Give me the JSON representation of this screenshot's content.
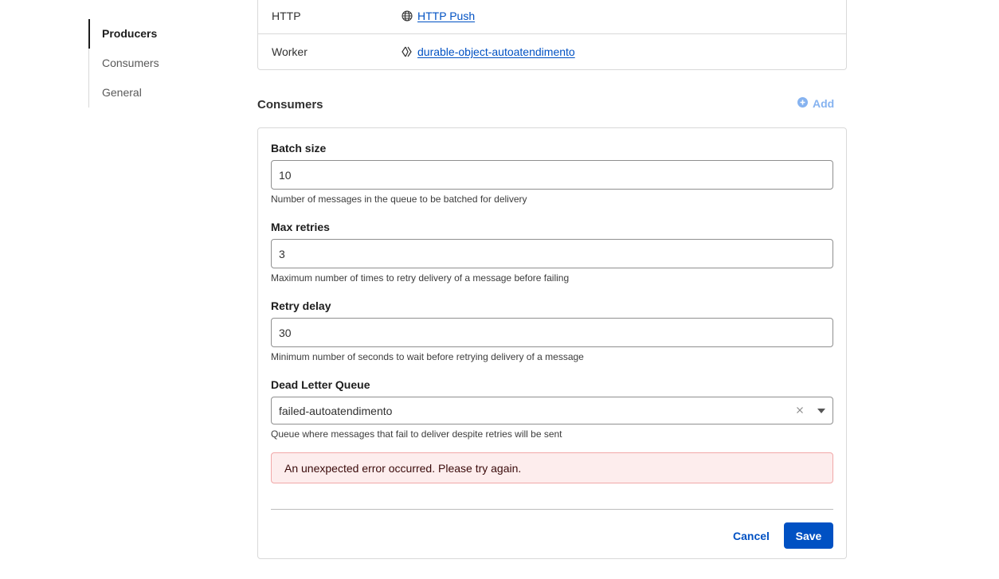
{
  "sidebar": {
    "items": [
      {
        "label": "Producers",
        "active": true
      },
      {
        "label": "Consumers",
        "active": false
      },
      {
        "label": "General",
        "active": false
      }
    ]
  },
  "producers": {
    "rows": [
      {
        "label": "HTTP",
        "icon": "globe-icon",
        "value": "HTTP Push"
      },
      {
        "label": "Worker",
        "icon": "worker-icon",
        "value": "durable-object-autoatendimento"
      }
    ]
  },
  "consumers": {
    "title": "Consumers",
    "add_label": "Add",
    "add_icon": "plus-circle-icon",
    "accent_color": "#86b3f0"
  },
  "form": {
    "batch_size": {
      "label": "Batch size",
      "value": "10",
      "hint": "Number of messages in the queue to be batched for delivery"
    },
    "max_retries": {
      "label": "Max retries",
      "value": "3",
      "hint": "Maximum number of times to retry delivery of a message before failing"
    },
    "retry_delay": {
      "label": "Retry delay",
      "value": "30",
      "hint": "Minimum number of seconds to wait before retrying delivery of a message"
    },
    "dead_letter_queue": {
      "label": "Dead Letter Queue",
      "value": "failed-autoatendimento",
      "hint": "Queue where messages that fail to deliver despite retries will be sent"
    },
    "error_message": "An unexpected error occurred. Please try again.",
    "cancel_label": "Cancel",
    "save_label": "Save"
  },
  "colors": {
    "primary": "#0051c3",
    "error_bg": "#fdeded",
    "error_border": "#f1a8a8"
  }
}
